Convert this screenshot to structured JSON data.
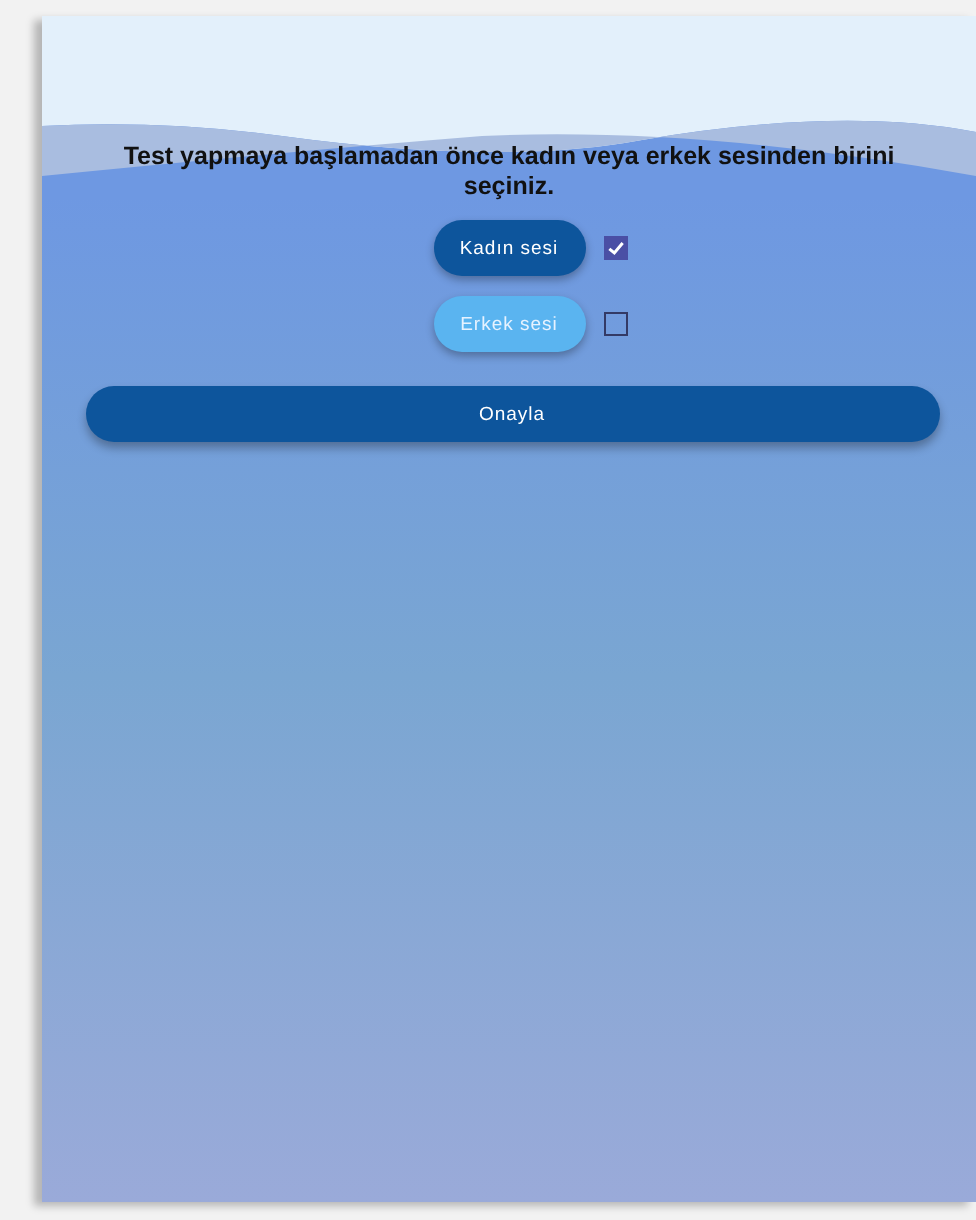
{
  "instruction": "Test yapmaya başlamadan önce kadın veya erkek sesinden birini seçiniz.",
  "voices": [
    {
      "label": "Kadın sesi",
      "checked": true
    },
    {
      "label": "Erkek sesi",
      "checked": false
    }
  ],
  "confirm_button": "Onayla"
}
